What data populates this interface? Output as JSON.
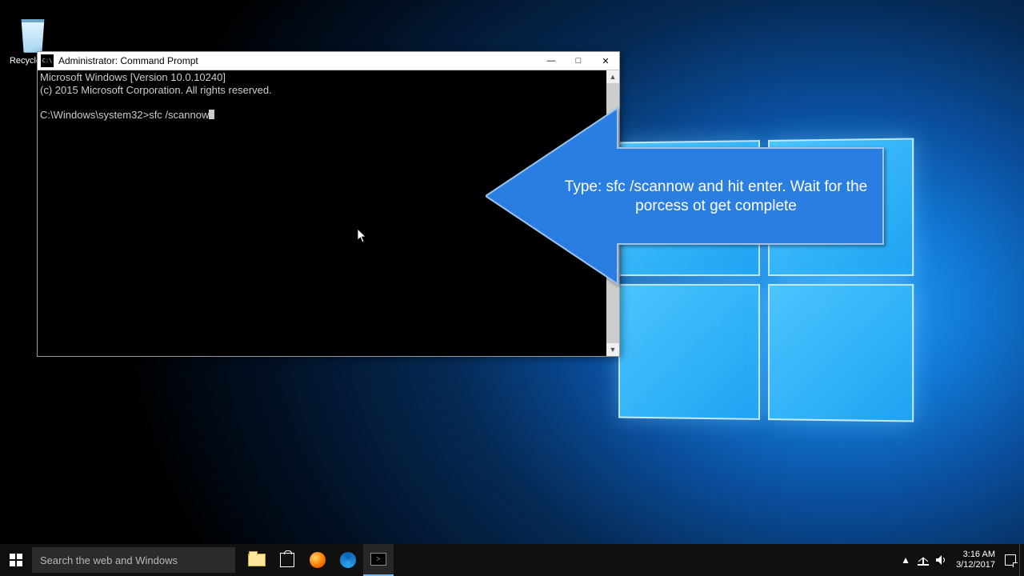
{
  "desktop": {
    "recycle_bin": "Recycle Bin"
  },
  "cmd": {
    "title": "Administrator: Command Prompt",
    "line1": "Microsoft Windows [Version 10.0.10240]",
    "line2": "(c) 2015 Microsoft Corporation. All rights reserved.",
    "prompt": "C:\\Windows\\system32>",
    "typed": "sfc /scannow"
  },
  "callout": {
    "text": "Type: sfc /scannow and hit enter. Wait for the porcess ot get complete"
  },
  "taskbar": {
    "search_placeholder": "Search the web and Windows",
    "time": "3:16 AM",
    "date": "3/12/2017"
  }
}
